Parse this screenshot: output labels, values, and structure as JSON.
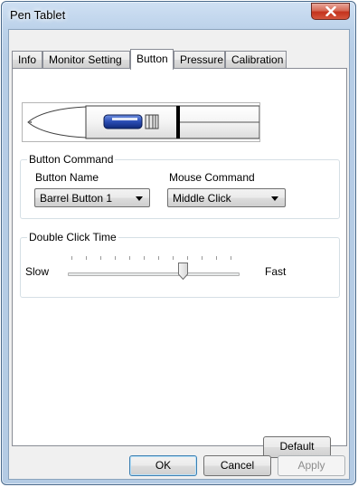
{
  "window": {
    "title": "Pen Tablet"
  },
  "tabs": [
    {
      "label": "Info"
    },
    {
      "label": "Monitor Setting"
    },
    {
      "label": "Button",
      "active": true
    },
    {
      "label": "Pressure"
    },
    {
      "label": "Calibration"
    }
  ],
  "button_command": {
    "title": "Button Command",
    "button_name_label": "Button Name",
    "button_name_value": "Barrel Button 1",
    "mouse_command_label": "Mouse Command",
    "mouse_command_value": "Middle Click"
  },
  "double_click": {
    "title": "Double Click Time",
    "min_label": "Slow",
    "max_label": "Fast",
    "value_fraction": 0.67
  },
  "buttons": {
    "default": "Default",
    "ok": "OK",
    "cancel": "Cancel",
    "apply": "Apply"
  },
  "colors": {
    "accent": "#3c7fb1",
    "close": "#c4321c",
    "pen_button": "#1c3f9c"
  },
  "icons": [
    "close-icon",
    "chevron-down-icon",
    "pen-icon",
    "slider-thumb-icon"
  ]
}
